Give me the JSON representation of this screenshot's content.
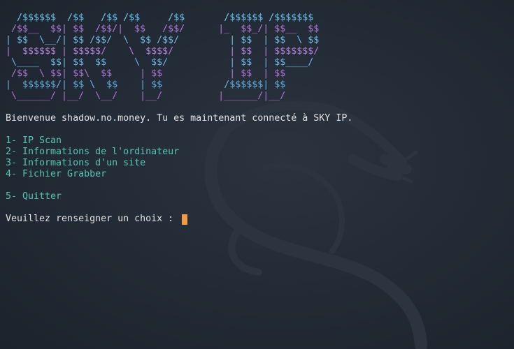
{
  "banner": {
    "lines": [
      "  /$$$$$$  /$$   /$$ /$$     /$$       /$$$$$$ /$$$$$$$",
      " /$$__  $$| $$  /$$/|  $$   /$$/      |_  $$_/| $$__  $$",
      "| $$  \\__/| $$ /$$/  \\  $$ /$$/         | $$  | $$  \\ $$",
      "|  $$$$$$ | $$$$$/    \\  $$$$/          | $$  | $$$$$$$/",
      " \\____  $$| $$  $$     \\  $$/           | $$  | $$____/",
      " /$$  \\ $$| $$\\  $$     | $$            | $$  | $$",
      "|  $$$$$$/| $$ \\  $$    | $$           /$$$$$$| $$",
      " \\______/ |__/  \\__/    |__/          |______/|__/"
    ],
    "colors": [
      "#6ec8f0",
      "#b07ad8",
      "#74bde6",
      "#b480d8",
      "#6db4e2",
      "#ad76d2",
      "#66b2e2",
      "#ae74cc"
    ]
  },
  "welcome": "Bienvenue shadow.no.money. Tu es maintenant connecté à SKY IP.",
  "menu": {
    "items": [
      "1- IP Scan",
      "2- Informations de l'ordinateur",
      "3- Informations d'un site",
      "4- Fichier Grabber"
    ],
    "quit": "5- Quitter"
  },
  "prompt": {
    "text": "Veuillez renseigner un choix : "
  },
  "theme": {
    "background": "#222a35",
    "menu_color": "#58c5b3",
    "cursor_color": "#f09b46"
  },
  "icons": {
    "background": "kali-dragon-watermark"
  }
}
